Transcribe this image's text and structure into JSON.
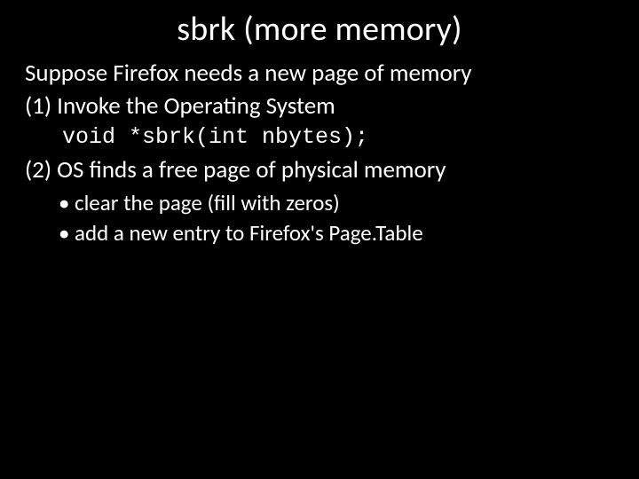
{
  "title": "sbrk (more memory)",
  "lines": {
    "l0": "Suppose Firefox needs a new page of memory",
    "l1": "(1) Invoke the Operating System",
    "code": "void *sbrk(int nbytes);",
    "l2": "(2) OS finds a free page of physical memory"
  },
  "bullets": {
    "b0": "clear the page (fill with zeros)",
    "b1": "add a new entry to Firefox's Page.Table"
  }
}
